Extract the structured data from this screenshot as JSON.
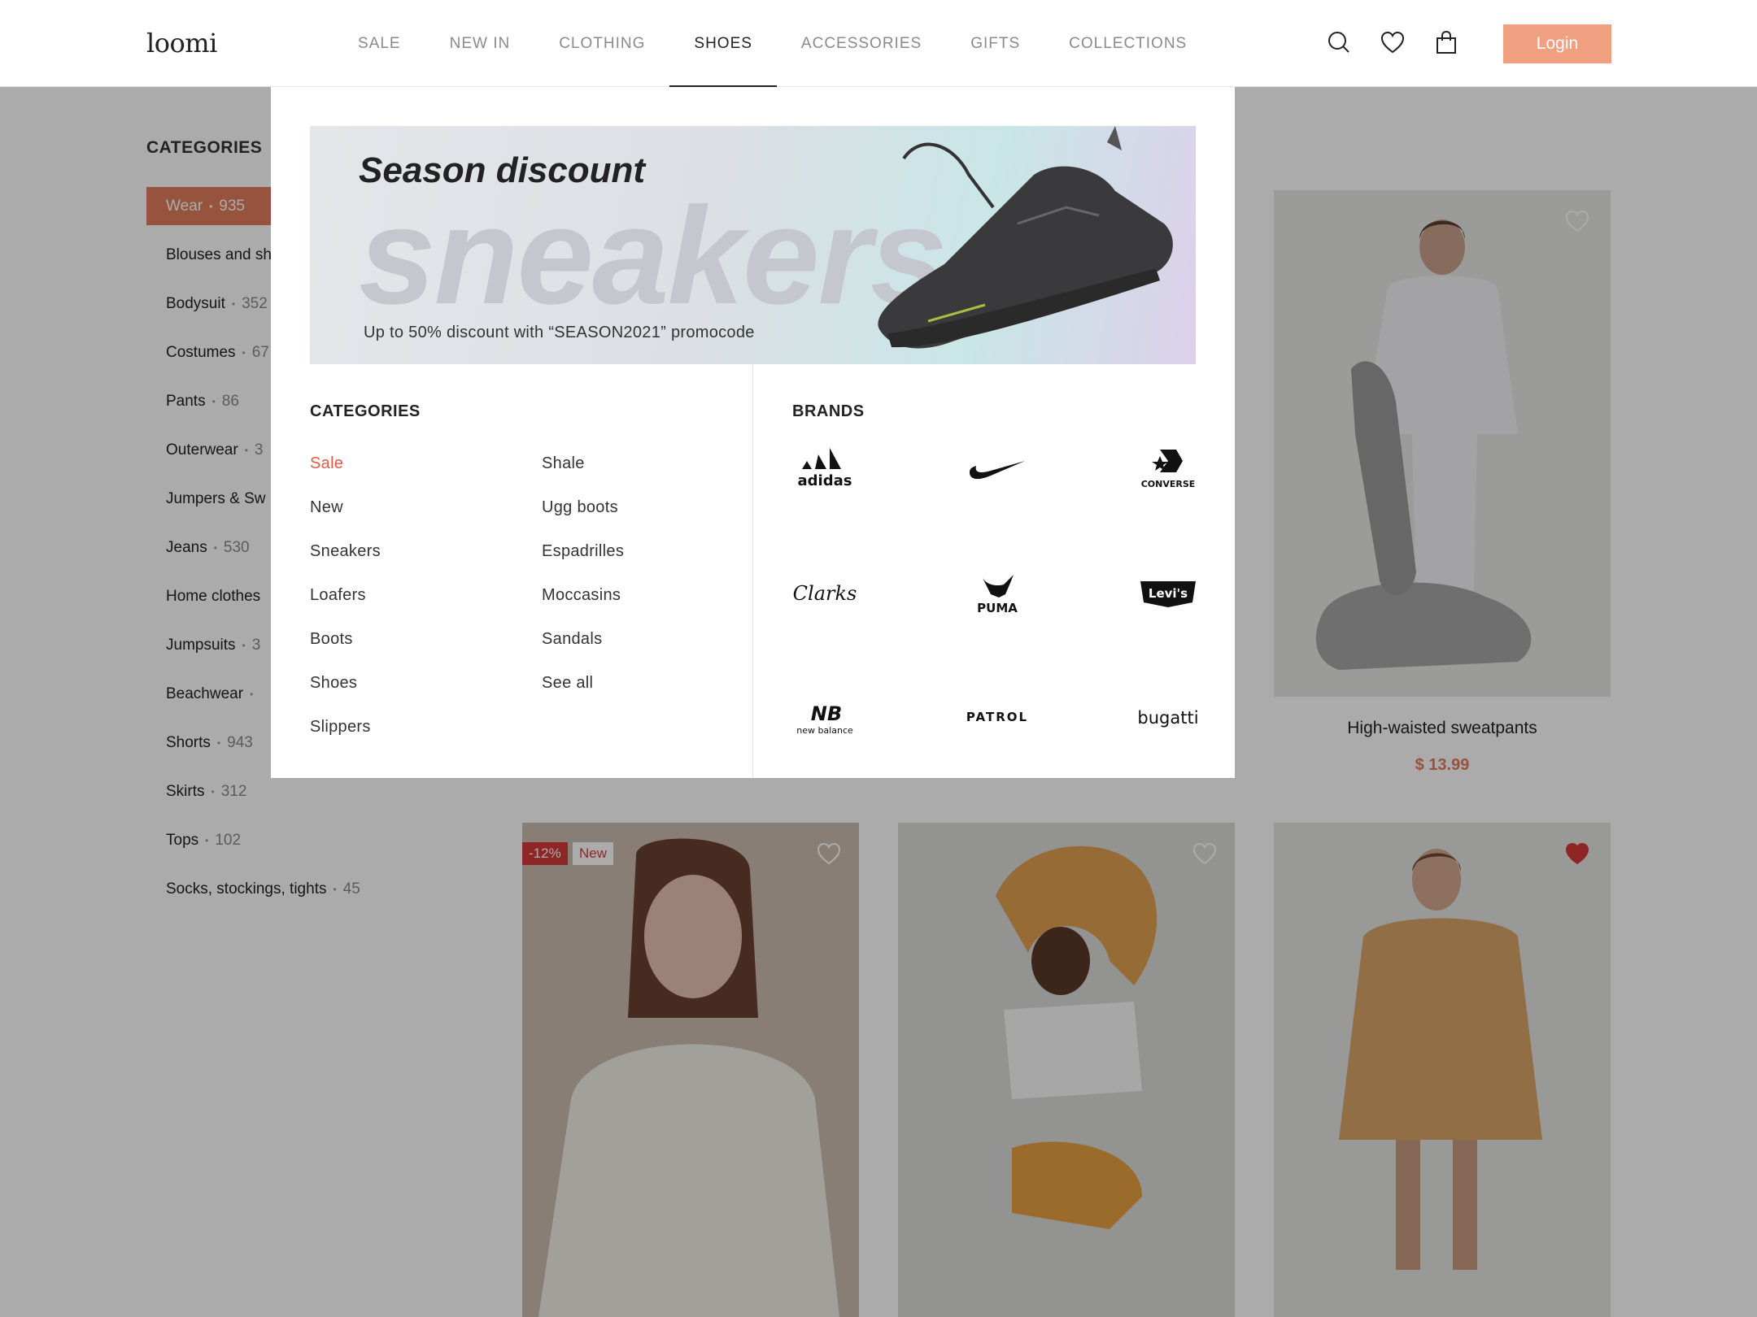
{
  "header": {
    "logo": "loomi",
    "nav": [
      "SALE",
      "NEW IN",
      "CLOTHING",
      "SHOES",
      "ACCESSORIES",
      "GIFTS",
      "COLLECTIONS"
    ],
    "active_nav": "SHOES",
    "login_label": "Login",
    "icons": [
      "search-icon",
      "heart-icon",
      "bag-icon"
    ]
  },
  "sidebar": {
    "title": "CATEGORIES",
    "items": [
      {
        "label": "Wear",
        "count": "935"
      },
      {
        "label": "Blouses and sh",
        "count": ""
      },
      {
        "label": "Bodysuit",
        "count": "352"
      },
      {
        "label": "Costumes",
        "count": "67"
      },
      {
        "label": "Pants",
        "count": "86"
      },
      {
        "label": "Outerwear",
        "count": "3"
      },
      {
        "label": "Jumpers & Sw",
        "count": ""
      },
      {
        "label": "Jeans",
        "count": "530"
      },
      {
        "label": "Home clothes",
        "count": ""
      },
      {
        "label": "Jumpsuits",
        "count": "3"
      },
      {
        "label": "Beachwear",
        "count": ""
      },
      {
        "label": "Shorts",
        "count": "943"
      },
      {
        "label": "Skirts",
        "count": "312"
      },
      {
        "label": "Tops",
        "count": "102"
      },
      {
        "label": "Socks, stockings, tights",
        "count": "45"
      }
    ]
  },
  "products": {
    "featured": {
      "name": "High-waisted sweatpants",
      "price": "$ 13.99"
    },
    "badges": {
      "discount": "-12%",
      "new": "New"
    }
  },
  "dropdown": {
    "banner": {
      "title": "Season discount",
      "big_text": "sneakers",
      "subtitle": "Up to 50% discount with “SEASON2021” promocode"
    },
    "categories_title": "CATEGORIES",
    "categories_col1": [
      "Sale",
      "New",
      "Sneakers",
      "Loafers",
      "Boots",
      "Shoes",
      "Slippers"
    ],
    "categories_col2": [
      "Shale",
      "Ugg boots",
      "Espadrilles",
      "Moccasins",
      "Sandals",
      "See all"
    ],
    "brands_title": "BRANDS",
    "brands": [
      "adidas",
      "nike",
      "CONVERSE",
      "Clarks",
      "PUMA",
      "Levi's",
      "new balance",
      "PATROL",
      "bugatti"
    ]
  },
  "colors": {
    "accent": "#f0a080",
    "active_category": "#e07d5c",
    "sale": "#e05a4a",
    "heart_active": "#d63a3a"
  }
}
